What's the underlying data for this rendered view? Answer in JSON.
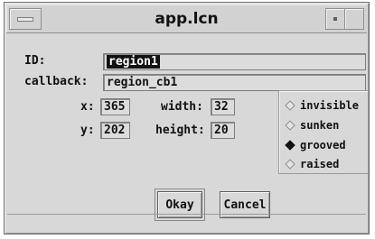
{
  "window": {
    "title": "app.lcn"
  },
  "labels": {
    "id": "ID:",
    "callback": "callback:",
    "x": "x:",
    "y": "y:",
    "width": "width:",
    "height": "height:"
  },
  "fields": {
    "id": "region1",
    "callback": "region_cb1",
    "x": "365",
    "y": "202",
    "width": "32",
    "height": "20"
  },
  "border_style": {
    "options": [
      "invisible",
      "sunken",
      "grooved",
      "raised"
    ],
    "selected": "grooved"
  },
  "buttons": {
    "okay": "Okay",
    "cancel": "Cancel"
  },
  "colors": {
    "background": "#d8d8d8",
    "field_bg": "#dcdcdc",
    "selection": "#111111"
  },
  "icons": {
    "window_menu": "window-menu-icon",
    "minimize": "minimize-icon",
    "maximize": "maximize-icon"
  }
}
